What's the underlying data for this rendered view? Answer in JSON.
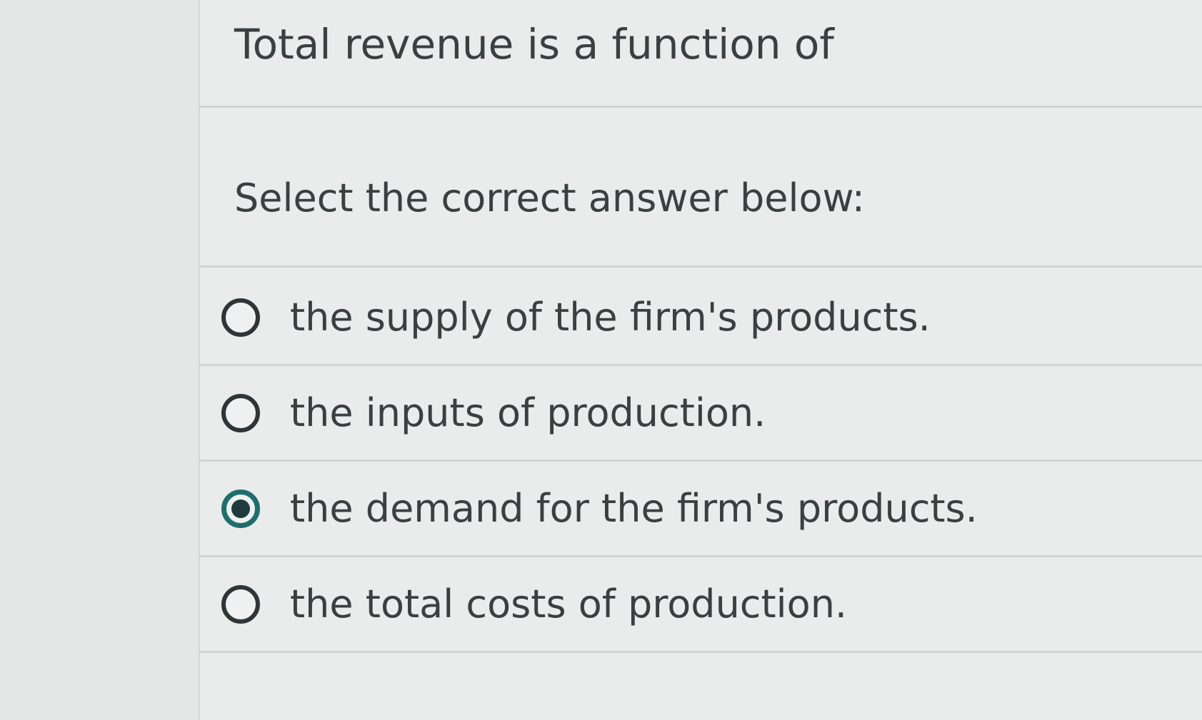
{
  "question": {
    "text": "Total revenue is a function of"
  },
  "instruction": "Select the correct answer below:",
  "options": [
    {
      "label": "the supply of the firm's products.",
      "selected": false
    },
    {
      "label": "the inputs of production.",
      "selected": false
    },
    {
      "label": "the demand for the firm's products.",
      "selected": true
    },
    {
      "label": "the total costs of production.",
      "selected": false
    }
  ],
  "colors": {
    "selected_ring": "#1f6e6c",
    "radio_ring": "#2f3537",
    "text": "#3a3f41"
  }
}
